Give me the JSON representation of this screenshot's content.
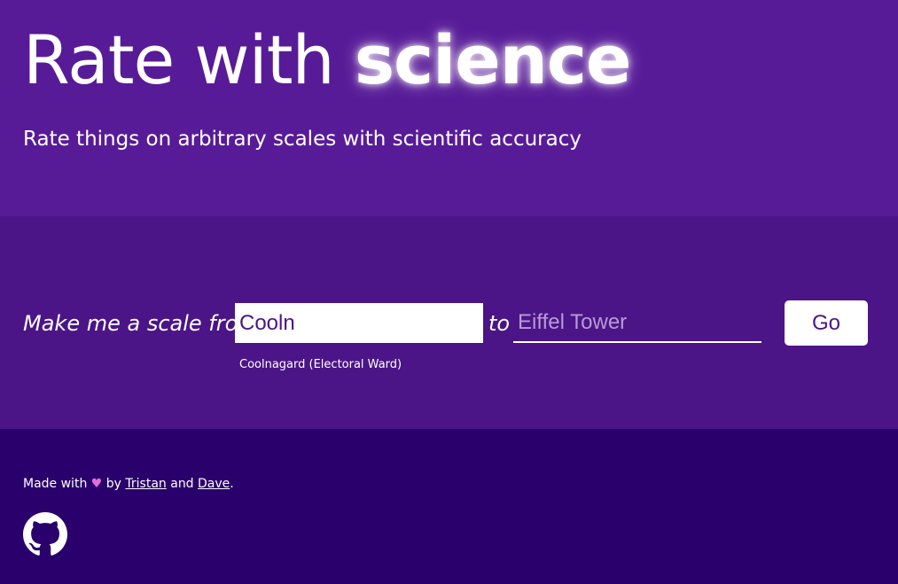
{
  "hero": {
    "title_plain": "Rate with ",
    "title_strong": "science",
    "subtitle": "Rate things on arbitrary scales with scientific accuracy"
  },
  "form": {
    "lead": "Make me a scale from",
    "from_value": "Cooln",
    "suggestion": "Coolnagard (Electoral Ward)",
    "to_label": "to",
    "to_placeholder": "Eiffel Tower",
    "go_label": "Go"
  },
  "footer": {
    "made_with": "Made with",
    "heart": "♥",
    "by": "by",
    "author_1": "Tristan",
    "and": "and",
    "author_2": "Dave",
    "period": ".",
    "github_icon": "github-icon"
  },
  "colors": {
    "hero_bg": "#581b98",
    "form_bg": "#4b1587",
    "footer_bg": "#2a006c",
    "heart": "#e070d8"
  }
}
